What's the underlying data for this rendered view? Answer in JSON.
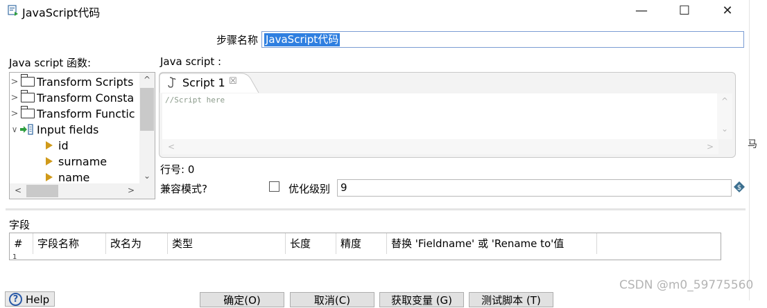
{
  "window": {
    "title": "JavaScript代码",
    "minimize_label": "—",
    "maximize_label": "☐",
    "close_label": "✕",
    "edge_glyph": "马"
  },
  "step": {
    "label": "步骤名称",
    "value": "JavaScript代码"
  },
  "functions_panel": {
    "label": "Java script 函数:",
    "items": [
      {
        "label": "Transform Scripts",
        "type": "folder",
        "expanded": false
      },
      {
        "label": "Transform Consta",
        "type": "folder",
        "expanded": false
      },
      {
        "label": "Transform Functic",
        "type": "folder",
        "expanded": false
      },
      {
        "label": "Input fields",
        "type": "input-fields",
        "expanded": true
      },
      {
        "label": "id",
        "type": "field"
      },
      {
        "label": "surname",
        "type": "field"
      },
      {
        "label": "name",
        "type": "field"
      }
    ]
  },
  "script_panel": {
    "label": "Java script :",
    "tab_label": "Script 1",
    "tab_close": "☒",
    "code": "//Script here"
  },
  "status": {
    "line_number": "行号: 0",
    "compat_label": "兼容模式?",
    "compat_checked": false,
    "opt_label": "优化级别",
    "opt_value": "9"
  },
  "fields_section": {
    "label": "字段",
    "columns": [
      "#",
      "字段名称",
      "改名为",
      "类型",
      "长度",
      "精度",
      "替换 'Fieldname' 或 'Rename to'值"
    ],
    "rows": [
      "1"
    ]
  },
  "buttons": {
    "help": "Help",
    "ok": "确定(O)",
    "cancel": "取消(C)",
    "get_vars": "获取变量 (G)",
    "test_script": "测试脚本 (T)"
  },
  "watermark": "CSDN @m0_59775560",
  "colors": {
    "selection": "#2f7fe0",
    "field_marker": "#d09a1a",
    "help_accent": "#2b5aa8"
  }
}
